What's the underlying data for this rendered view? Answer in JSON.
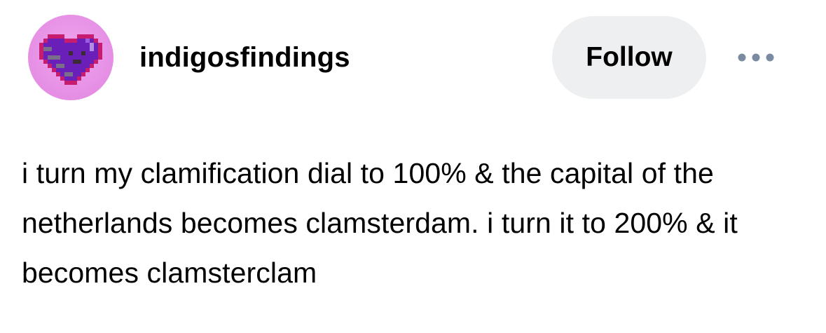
{
  "post": {
    "author": {
      "username": "indigosfindings",
      "avatar_icon": "pixel-heart-icon",
      "avatar_colors": {
        "background": "#e58ee4",
        "heart": "#6a1fb8",
        "outline": "#e0348a"
      }
    },
    "actions": {
      "follow_label": "Follow",
      "more_icon": "more-options-icon"
    },
    "body_text": "i turn my clamification dial to 100% & the capital of the netherlands becomes clamsterdam. i turn it to 200% & it becomes clamsterclam"
  },
  "colors": {
    "follow_button_bg": "#eeeff1",
    "more_dots": "#7a8aa0",
    "text": "#000000"
  }
}
